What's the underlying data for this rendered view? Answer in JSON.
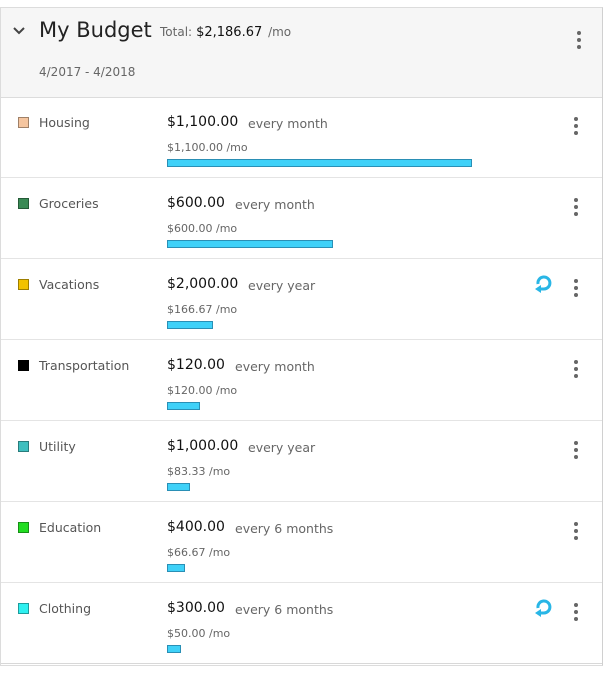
{
  "budget": {
    "title": "My Budget",
    "total_label": "Total:",
    "total_amount": "$2,186.67",
    "total_unit": "/mo",
    "date_range": "4/2017 - 4/2018"
  },
  "colors": {
    "bar": "#3fd1f8",
    "recurring_icon": "#29b6e6"
  },
  "items": [
    {
      "name": "Housing",
      "color": "#f5c59f",
      "amount": "$1,100.00",
      "frequency": "every month",
      "per_month": "$1,100.00 /mo",
      "per_month_value": 1100,
      "recurring": false
    },
    {
      "name": "Groceries",
      "color": "#3a8a55",
      "amount": "$600.00",
      "frequency": "every month",
      "per_month": "$600.00 /mo",
      "per_month_value": 600,
      "recurring": false
    },
    {
      "name": "Vacations",
      "color": "#f2c200",
      "amount": "$2,000.00",
      "frequency": "every year",
      "per_month": "$166.67 /mo",
      "per_month_value": 166.67,
      "recurring": true
    },
    {
      "name": "Transportation",
      "color": "#000000",
      "amount": "$120.00",
      "frequency": "every month",
      "per_month": "$120.00 /mo",
      "per_month_value": 120,
      "recurring": false
    },
    {
      "name": "Utility",
      "color": "#3fbfbf",
      "amount": "$1,000.00",
      "frequency": "every year",
      "per_month": "$83.33 /mo",
      "per_month_value": 83.33,
      "recurring": false
    },
    {
      "name": "Education",
      "color": "#22dd22",
      "amount": "$400.00",
      "frequency": "every 6 months",
      "per_month": "$66.67 /mo",
      "per_month_value": 66.67,
      "recurring": false
    },
    {
      "name": "Clothing",
      "color": "#2ef0f0",
      "amount": "$300.00",
      "frequency": "every 6 months",
      "per_month": "$50.00 /mo",
      "per_month_value": 50,
      "recurring": true
    }
  ]
}
